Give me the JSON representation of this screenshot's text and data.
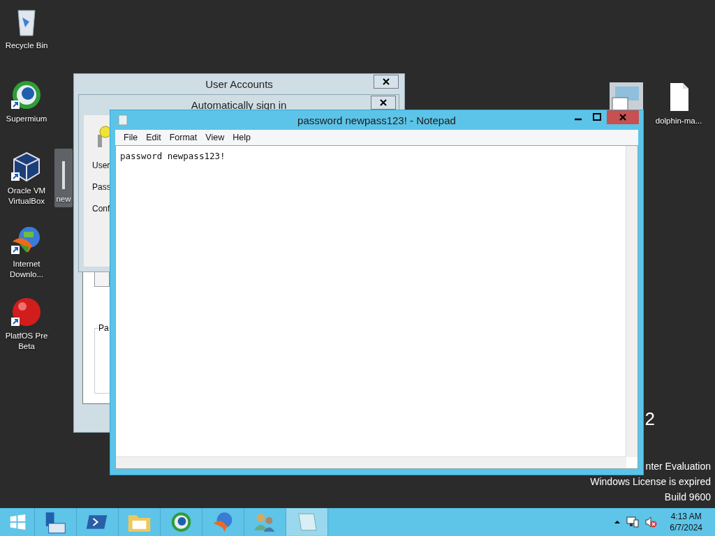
{
  "desktop_icons": [
    {
      "label": "Recycle Bin",
      "kind": "bin",
      "shortcut": false,
      "selected": false
    },
    {
      "label": "Supermium",
      "kind": "browser",
      "shortcut": true,
      "selected": false
    },
    {
      "label": "Oracle VM VirtualBox",
      "kind": "cube",
      "shortcut": true,
      "selected": false
    },
    {
      "label": "Internet Downlo...",
      "kind": "globe",
      "shortcut": true,
      "selected": false
    },
    {
      "label": "PlatfOS Pre Beta",
      "kind": "ball",
      "shortcut": true,
      "selected": false
    },
    {
      "label": "new",
      "selected": true
    },
    {
      "label": "dolphin-ma...",
      "kind": "file",
      "shortcut": false,
      "selected": false
    }
  ],
  "desktop_text": [
    "2",
    "nter Evaluation",
    "Windows License is expired",
    "Build 9600"
  ],
  "user_accounts": {
    "title": "User Accounts",
    "dialog": {
      "title": "Automatically sign in",
      "labels": [
        "User",
        "Pass",
        "Conf"
      ]
    },
    "group_label": "Pa"
  },
  "notepad": {
    "title": "password newpass123! - Notepad",
    "menu": [
      "File",
      "Edit",
      "Format",
      "View",
      "Help"
    ],
    "text": "password newpass123!"
  },
  "taskbar": {
    "apps": [
      {
        "kind": "server",
        "active": false
      },
      {
        "kind": "shell",
        "active": false
      },
      {
        "kind": "folder",
        "active": false
      },
      {
        "kind": "browser",
        "active": false
      },
      {
        "kind": "globe",
        "active": false
      },
      {
        "kind": "users",
        "active": false
      },
      {
        "kind": "notepad",
        "active": true
      }
    ],
    "time": "4:13 AM",
    "date": "6/7/2024"
  }
}
